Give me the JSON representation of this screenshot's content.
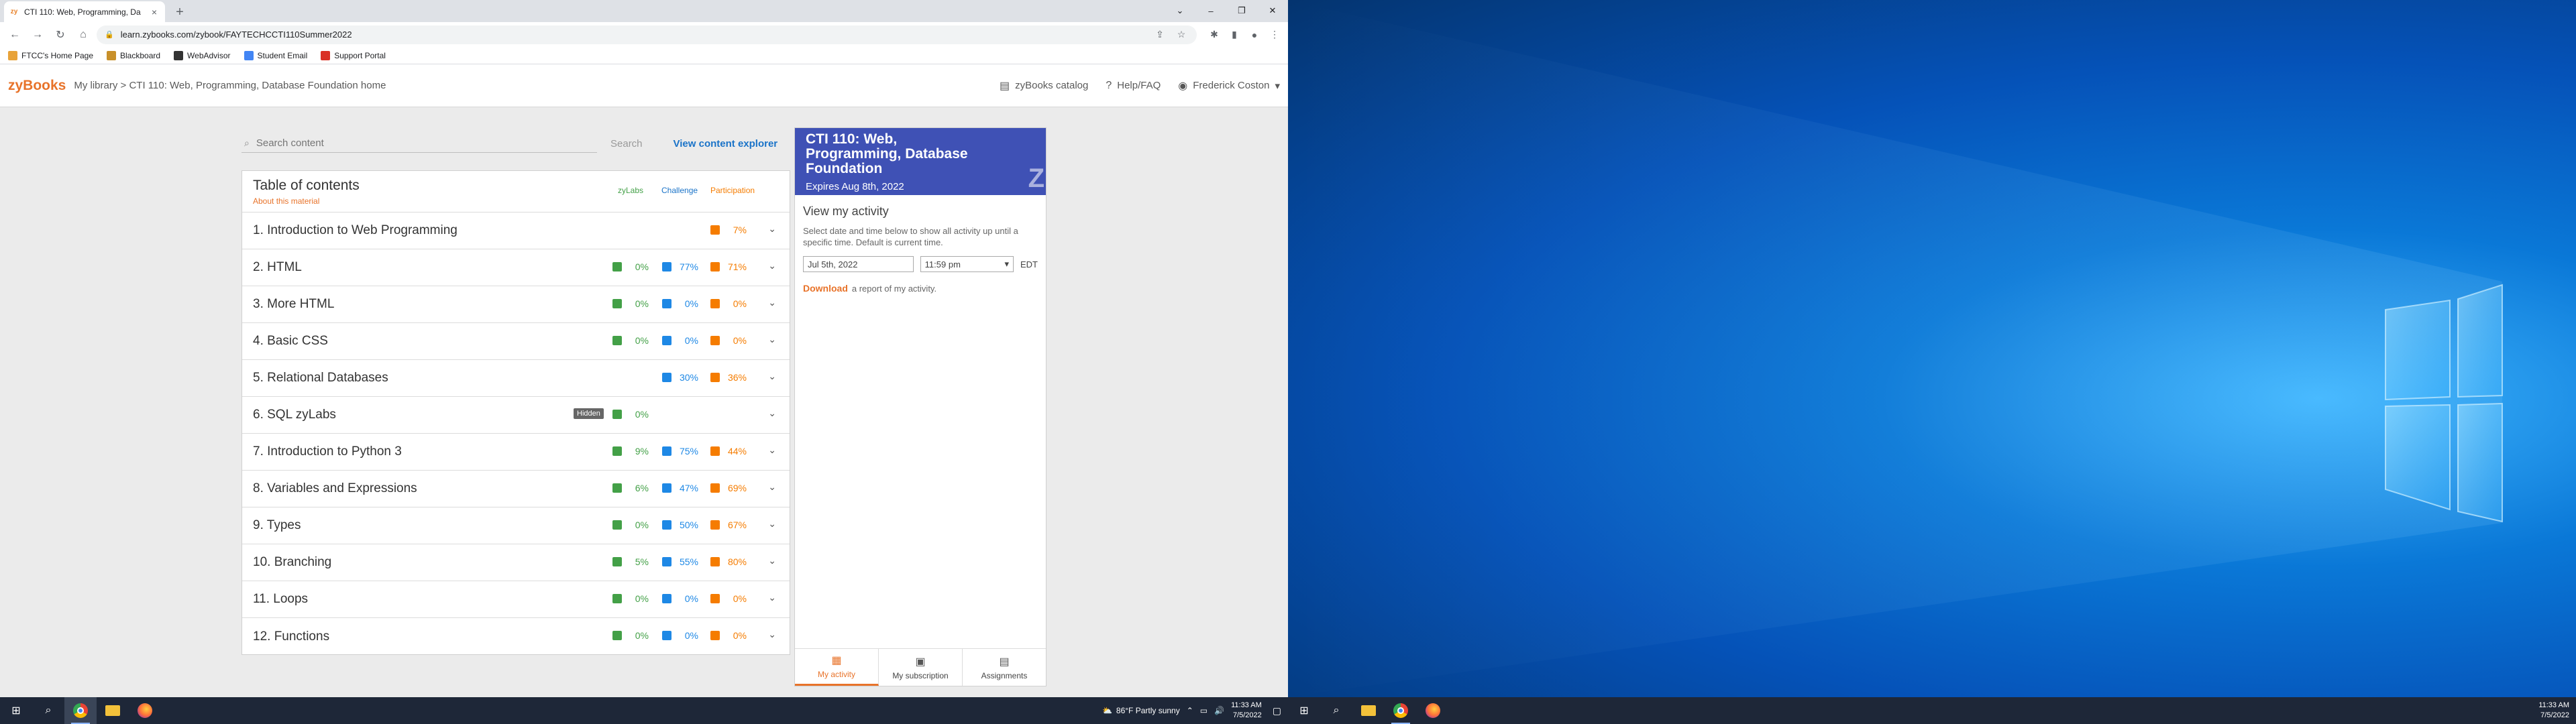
{
  "browser": {
    "tab_title": "CTI 110: Web, Programming, Da",
    "url": "learn.zybooks.com/zybook/FAYTECHCCTI110Summer2022",
    "bookmarks": [
      {
        "label": "FTCC's Home Page",
        "color": "#e8a33a"
      },
      {
        "label": "Blackboard",
        "color": "#c8902a"
      },
      {
        "label": "WebAdvisor",
        "color": "#333333"
      },
      {
        "label": "Student Email",
        "color": "#4285f4"
      },
      {
        "label": "Support Portal",
        "color": "#d93025"
      }
    ]
  },
  "header": {
    "logo": "zyBooks",
    "breadcrumb": "My library > CTI 110: Web, Programming, Database Foundation home",
    "catalog": "zyBooks catalog",
    "help": "Help/FAQ",
    "user": "Frederick Coston"
  },
  "search": {
    "placeholder": "Search content",
    "button": "Search",
    "explorer": "View content explorer"
  },
  "toc": {
    "title": "Table of contents",
    "about": "About this material",
    "col_zylabs": "zyLabs",
    "col_challenge": "Challenge",
    "col_participation": "Participation",
    "hidden_label": "Hidden",
    "rows": [
      {
        "name": "1. Introduction to Web Programming",
        "lab": null,
        "chal": null,
        "part": "7%"
      },
      {
        "name": "2. HTML",
        "lab": "0%",
        "chal": "77%",
        "part": "71%"
      },
      {
        "name": "3. More HTML",
        "lab": "0%",
        "chal": "0%",
        "part": "0%"
      },
      {
        "name": "4. Basic CSS",
        "lab": "0%",
        "chal": "0%",
        "part": "0%"
      },
      {
        "name": "5. Relational Databases",
        "lab": null,
        "chal": "30%",
        "part": "36%"
      },
      {
        "name": "6. SQL zyLabs",
        "lab": "0%",
        "chal": null,
        "part": null,
        "hidden": true
      },
      {
        "name": "7. Introduction to Python 3",
        "lab": "9%",
        "chal": "75%",
        "part": "44%"
      },
      {
        "name": "8. Variables and Expressions",
        "lab": "6%",
        "chal": "47%",
        "part": "69%"
      },
      {
        "name": "9. Types",
        "lab": "0%",
        "chal": "50%",
        "part": "67%"
      },
      {
        "name": "10. Branching",
        "lab": "5%",
        "chal": "55%",
        "part": "80%"
      },
      {
        "name": "11. Loops",
        "lab": "0%",
        "chal": "0%",
        "part": "0%"
      },
      {
        "name": "12. Functions",
        "lab": "0%",
        "chal": "0%",
        "part": "0%"
      }
    ]
  },
  "panel": {
    "title": "CTI 110: Web, Programming, Database Foundation",
    "expires": "Expires Aug 8th, 2022",
    "activity_title": "View my activity",
    "activity_desc": "Select date and time below to show all activity up until a specific time. Default is current time.",
    "date": "Jul 5th, 2022",
    "time": "11:59 pm",
    "timezone": "EDT",
    "download_link": "Download",
    "download_text": "a report of my activity.",
    "tabs": [
      "My activity",
      "My subscription",
      "Assignments"
    ]
  },
  "taskbar": {
    "weather": "86°F  Partly sunny",
    "time": "11:33 AM",
    "date": "7/5/2022"
  },
  "colors": {
    "accent": "#e8732a",
    "zylabs": "#43a047",
    "challenge": "#1e88e5",
    "participation": "#f57c00",
    "panel_header": "#3f51b5"
  }
}
